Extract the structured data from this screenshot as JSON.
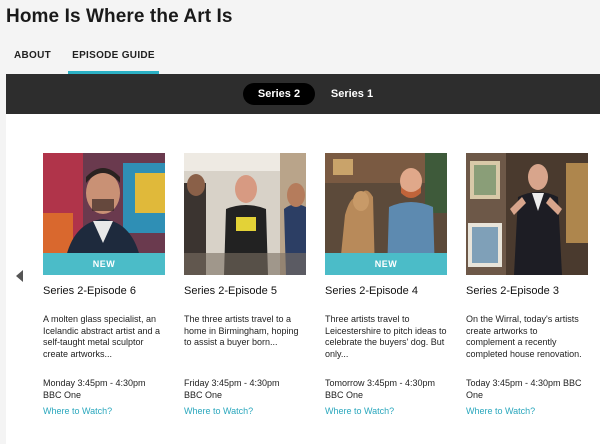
{
  "page": {
    "title": "Home Is Where the Art Is"
  },
  "tabs": [
    {
      "label": "ABOUT"
    },
    {
      "label": "EPISODE GUIDE"
    }
  ],
  "series": [
    {
      "label": "Series 2"
    },
    {
      "label": "Series 1"
    }
  ],
  "colors": {
    "accent": "#2bb0c4",
    "badge": "#4bbcc8",
    "bar": "#2d2d2d",
    "link": "#2aa7bd"
  },
  "episodes": [
    {
      "badge": "NEW",
      "title": "Series 2-Episode 6",
      "description": "A molten glass specialist, an Icelandic abstract artist and a self-taught metal sculptor create artworks...",
      "time": "Monday 3:45pm - 4:30pm",
      "channel": "BBC One",
      "watch": "Where to Watch?"
    },
    {
      "badge": "",
      "title": "Series 2-Episode 5",
      "description": "The three artists travel to a home in Birmingham, hoping to assist a buyer born...",
      "time": "Friday 3:45pm - 4:30pm",
      "channel": "BBC One",
      "watch": "Where to Watch?"
    },
    {
      "badge": "NEW",
      "title": "Series 2-Episode 4",
      "description": "Three artists travel to Leicestershire to pitch ideas to celebrate the buyers' dog. But only...",
      "time": "Tomorrow 3:45pm - 4:30pm BBC One",
      "channel": "",
      "watch": "Where to Watch?"
    },
    {
      "badge": "",
      "title": "Series 2-Episode 3",
      "description": "On the Wirral, today's artists create artworks to complement a recently completed house renovation. Presented...",
      "time": "Today 3:45pm - 4:30pm BBC One",
      "channel": "",
      "watch": "Where to Watch?"
    }
  ],
  "icons": {
    "prev": "chevron-left-icon"
  }
}
